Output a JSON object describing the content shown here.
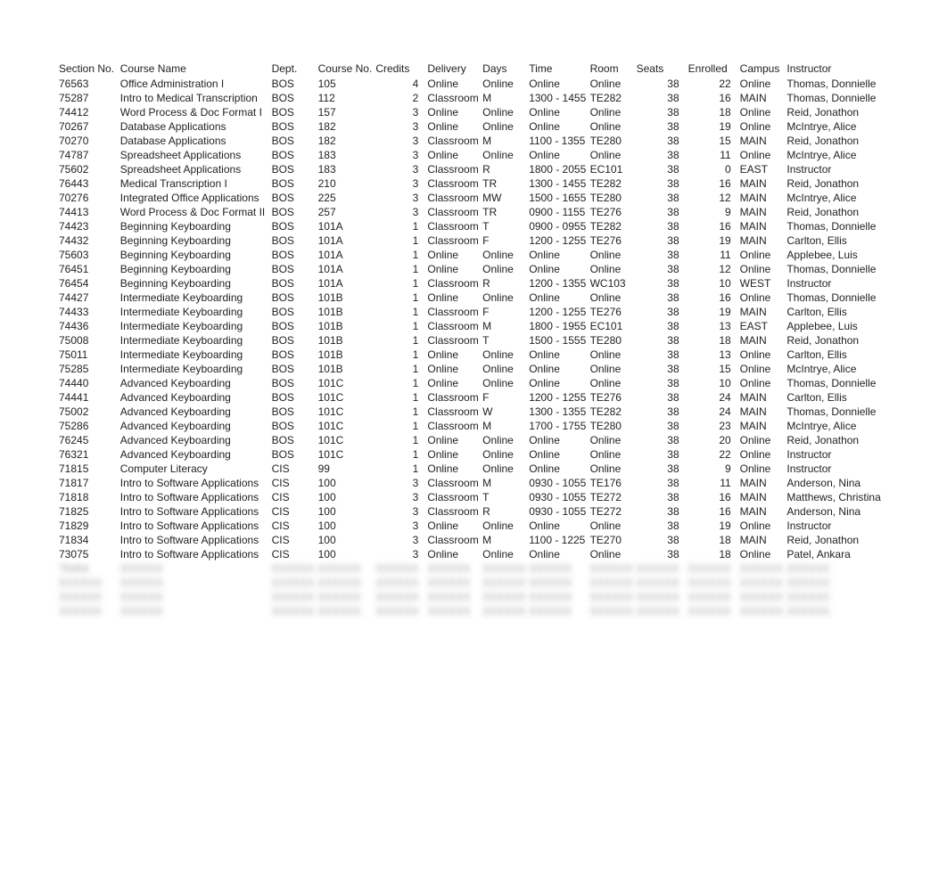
{
  "columns": [
    {
      "key": "section",
      "label": "Section No.",
      "cls": "c-section"
    },
    {
      "key": "name",
      "label": "Course Name",
      "cls": "c-name"
    },
    {
      "key": "dept",
      "label": "Dept.",
      "cls": "c-dept"
    },
    {
      "key": "course",
      "label": "Course No.",
      "cls": "c-course"
    },
    {
      "key": "credits",
      "label": "Credits",
      "cls": "c-credits"
    },
    {
      "key": "delivery",
      "label": "Delivery",
      "cls": "c-delivery"
    },
    {
      "key": "days",
      "label": "Days",
      "cls": "c-days"
    },
    {
      "key": "time",
      "label": "Time",
      "cls": "c-time"
    },
    {
      "key": "room",
      "label": "Room",
      "cls": "c-room"
    },
    {
      "key": "seats",
      "label": "Seats",
      "cls": "c-seats"
    },
    {
      "key": "enrolled",
      "label": "Enrolled",
      "cls": "c-enrolled"
    },
    {
      "key": "campus",
      "label": "Campus",
      "cls": "c-campus"
    },
    {
      "key": "instructor",
      "label": "Instructor",
      "cls": "c-instructor"
    }
  ],
  "rows": [
    {
      "section": "76563",
      "name": "Office Administration I",
      "dept": "BOS",
      "course": "105",
      "credits": "4",
      "delivery": "Online",
      "days": "Online",
      "time": "Online",
      "room": "Online",
      "seats": "38",
      "enrolled": "22",
      "campus": "Online",
      "instructor": "Thomas, Donnielle"
    },
    {
      "section": "75287",
      "name": "Intro to Medical Transcription",
      "dept": "BOS",
      "course": "112",
      "credits": "2",
      "delivery": "Classroom",
      "days": "M",
      "time": "1300 - 1455",
      "room": "TE282",
      "seats": "38",
      "enrolled": "16",
      "campus": "MAIN",
      "instructor": "Thomas, Donnielle"
    },
    {
      "section": "74412",
      "name": "Word Process & Doc Format I",
      "dept": "BOS",
      "course": "157",
      "credits": "3",
      "delivery": "Online",
      "days": "Online",
      "time": "Online",
      "room": "Online",
      "seats": "38",
      "enrolled": "18",
      "campus": "Online",
      "instructor": "Reid, Jonathon"
    },
    {
      "section": "70267",
      "name": "Database Applications",
      "dept": "BOS",
      "course": "182",
      "credits": "3",
      "delivery": "Online",
      "days": "Online",
      "time": "Online",
      "room": "Online",
      "seats": "38",
      "enrolled": "19",
      "campus": "Online",
      "instructor": "McIntrye, Alice"
    },
    {
      "section": "70270",
      "name": "Database Applications",
      "dept": "BOS",
      "course": "182",
      "credits": "3",
      "delivery": "Classroom",
      "days": "M",
      "time": "1100 - 1355",
      "room": "TE280",
      "seats": "38",
      "enrolled": "15",
      "campus": "MAIN",
      "instructor": "Reid, Jonathon"
    },
    {
      "section": "74787",
      "name": "Spreadsheet Applications",
      "dept": "BOS",
      "course": "183",
      "credits": "3",
      "delivery": "Online",
      "days": "Online",
      "time": "Online",
      "room": "Online",
      "seats": "38",
      "enrolled": "11",
      "campus": "Online",
      "instructor": "McIntrye, Alice"
    },
    {
      "section": "75602",
      "name": "Spreadsheet Applications",
      "dept": "BOS",
      "course": "183",
      "credits": "3",
      "delivery": "Classroom",
      "days": "R",
      "time": "1800 - 2055",
      "room": "EC101",
      "seats": "38",
      "enrolled": "0",
      "campus": "EAST",
      "instructor": "Instructor"
    },
    {
      "section": "76443",
      "name": "Medical Transcription I",
      "dept": "BOS",
      "course": "210",
      "credits": "3",
      "delivery": "Classroom",
      "days": "TR",
      "time": "1300 - 1455",
      "room": "TE282",
      "seats": "38",
      "enrolled": "16",
      "campus": "MAIN",
      "instructor": "Reid, Jonathon"
    },
    {
      "section": "70276",
      "name": "Integrated Office Applications",
      "dept": "BOS",
      "course": "225",
      "credits": "3",
      "delivery": "Classroom",
      "days": "MW",
      "time": "1500 - 1655",
      "room": "TE280",
      "seats": "38",
      "enrolled": "12",
      "campus": "MAIN",
      "instructor": "McIntrye, Alice"
    },
    {
      "section": "74413",
      "name": "Word Process & Doc Format II",
      "dept": "BOS",
      "course": "257",
      "credits": "3",
      "delivery": "Classroom",
      "days": "TR",
      "time": "0900 - 1155",
      "room": "TE276",
      "seats": "38",
      "enrolled": "9",
      "campus": "MAIN",
      "instructor": "Reid, Jonathon"
    },
    {
      "section": "74423",
      "name": "Beginning Keyboarding",
      "dept": "BOS",
      "course": "101A",
      "credits": "1",
      "delivery": "Classroom",
      "days": "T",
      "time": "0900 - 0955",
      "room": "TE282",
      "seats": "38",
      "enrolled": "16",
      "campus": "MAIN",
      "instructor": "Thomas, Donnielle"
    },
    {
      "section": "74432",
      "name": "Beginning Keyboarding",
      "dept": "BOS",
      "course": "101A",
      "credits": "1",
      "delivery": "Classroom",
      "days": "F",
      "time": "1200 - 1255",
      "room": "TE276",
      "seats": "38",
      "enrolled": "19",
      "campus": "MAIN",
      "instructor": "Carlton, Ellis"
    },
    {
      "section": "75603",
      "name": "Beginning Keyboarding",
      "dept": "BOS",
      "course": "101A",
      "credits": "1",
      "delivery": "Online",
      "days": "Online",
      "time": "Online",
      "room": "Online",
      "seats": "38",
      "enrolled": "11",
      "campus": "Online",
      "instructor": "Applebee, Luis"
    },
    {
      "section": "76451",
      "name": "Beginning Keyboarding",
      "dept": "BOS",
      "course": "101A",
      "credits": "1",
      "delivery": "Online",
      "days": "Online",
      "time": "Online",
      "room": "Online",
      "seats": "38",
      "enrolled": "12",
      "campus": "Online",
      "instructor": "Thomas, Donnielle"
    },
    {
      "section": "76454",
      "name": "Beginning Keyboarding",
      "dept": "BOS",
      "course": "101A",
      "credits": "1",
      "delivery": "Classroom",
      "days": "R",
      "time": "1200 - 1355",
      "room": "WC103",
      "seats": "38",
      "enrolled": "10",
      "campus": "WEST",
      "instructor": "Instructor"
    },
    {
      "section": "74427",
      "name": "Intermediate Keyboarding",
      "dept": "BOS",
      "course": "101B",
      "credits": "1",
      "delivery": "Online",
      "days": "Online",
      "time": "Online",
      "room": "Online",
      "seats": "38",
      "enrolled": "16",
      "campus": "Online",
      "instructor": "Thomas, Donnielle"
    },
    {
      "section": "74433",
      "name": "Intermediate Keyboarding",
      "dept": "BOS",
      "course": "101B",
      "credits": "1",
      "delivery": "Classroom",
      "days": "F",
      "time": "1200 - 1255",
      "room": "TE276",
      "seats": "38",
      "enrolled": "19",
      "campus": "MAIN",
      "instructor": "Carlton, Ellis"
    },
    {
      "section": "74436",
      "name": "Intermediate Keyboarding",
      "dept": "BOS",
      "course": "101B",
      "credits": "1",
      "delivery": "Classroom",
      "days": "M",
      "time": "1800 - 1955",
      "room": "EC101",
      "seats": "38",
      "enrolled": "13",
      "campus": "EAST",
      "instructor": "Applebee, Luis"
    },
    {
      "section": "75008",
      "name": "Intermediate Keyboarding",
      "dept": "BOS",
      "course": "101B",
      "credits": "1",
      "delivery": "Classroom",
      "days": "T",
      "time": "1500 - 1555",
      "room": "TE280",
      "seats": "38",
      "enrolled": "18",
      "campus": "MAIN",
      "instructor": "Reid, Jonathon"
    },
    {
      "section": "75011",
      "name": "Intermediate Keyboarding",
      "dept": "BOS",
      "course": "101B",
      "credits": "1",
      "delivery": "Online",
      "days": "Online",
      "time": "Online",
      "room": "Online",
      "seats": "38",
      "enrolled": "13",
      "campus": "Online",
      "instructor": "Carlton, Ellis"
    },
    {
      "section": "75285",
      "name": "Intermediate Keyboarding",
      "dept": "BOS",
      "course": "101B",
      "credits": "1",
      "delivery": "Online",
      "days": "Online",
      "time": "Online",
      "room": "Online",
      "seats": "38",
      "enrolled": "15",
      "campus": "Online",
      "instructor": "McIntrye, Alice"
    },
    {
      "section": "74440",
      "name": "Advanced Keyboarding",
      "dept": "BOS",
      "course": "101C",
      "credits": "1",
      "delivery": "Online",
      "days": "Online",
      "time": "Online",
      "room": "Online",
      "seats": "38",
      "enrolled": "10",
      "campus": "Online",
      "instructor": "Thomas, Donnielle"
    },
    {
      "section": "74441",
      "name": "Advanced Keyboarding",
      "dept": "BOS",
      "course": "101C",
      "credits": "1",
      "delivery": "Classroom",
      "days": "F",
      "time": "1200 - 1255",
      "room": "TE276",
      "seats": "38",
      "enrolled": "24",
      "campus": "MAIN",
      "instructor": "Carlton, Ellis"
    },
    {
      "section": "75002",
      "name": "Advanced Keyboarding",
      "dept": "BOS",
      "course": "101C",
      "credits": "1",
      "delivery": "Classroom",
      "days": "W",
      "time": "1300 - 1355",
      "room": "TE282",
      "seats": "38",
      "enrolled": "24",
      "campus": "MAIN",
      "instructor": "Thomas, Donnielle"
    },
    {
      "section": "75286",
      "name": "Advanced Keyboarding",
      "dept": "BOS",
      "course": "101C",
      "credits": "1",
      "delivery": "Classroom",
      "days": "M",
      "time": "1700 - 1755",
      "room": "TE280",
      "seats": "38",
      "enrolled": "23",
      "campus": "MAIN",
      "instructor": "McIntrye, Alice"
    },
    {
      "section": "76245",
      "name": "Advanced Keyboarding",
      "dept": "BOS",
      "course": "101C",
      "credits": "1",
      "delivery": "Online",
      "days": "Online",
      "time": "Online",
      "room": "Online",
      "seats": "38",
      "enrolled": "20",
      "campus": "Online",
      "instructor": "Reid, Jonathon"
    },
    {
      "section": "76321",
      "name": "Advanced Keyboarding",
      "dept": "BOS",
      "course": "101C",
      "credits": "1",
      "delivery": "Online",
      "days": "Online",
      "time": "Online",
      "room": "Online",
      "seats": "38",
      "enrolled": "22",
      "campus": "Online",
      "instructor": "Instructor"
    },
    {
      "section": "71815",
      "name": "Computer Literacy",
      "dept": "CIS",
      "course": "99",
      "credits": "1",
      "delivery": "Online",
      "days": "Online",
      "time": "Online",
      "room": "Online",
      "seats": "38",
      "enrolled": "9",
      "campus": "Online",
      "instructor": "Instructor"
    },
    {
      "section": "71817",
      "name": "Intro to Software Applications",
      "dept": "CIS",
      "course": "100",
      "credits": "3",
      "delivery": "Classroom",
      "days": "M",
      "time": "0930 - 1055",
      "room": "TE176",
      "seats": "38",
      "enrolled": "11",
      "campus": "MAIN",
      "instructor": "Anderson, Nina"
    },
    {
      "section": "71818",
      "name": "Intro to Software Applications",
      "dept": "CIS",
      "course": "100",
      "credits": "3",
      "delivery": "Classroom",
      "days": "T",
      "time": "0930 - 1055",
      "room": "TE272",
      "seats": "38",
      "enrolled": "16",
      "campus": "MAIN",
      "instructor": "Matthews, Christina"
    },
    {
      "section": "71825",
      "name": "Intro to Software Applications",
      "dept": "CIS",
      "course": "100",
      "credits": "3",
      "delivery": "Classroom",
      "days": "R",
      "time": "0930 - 1055",
      "room": "TE272",
      "seats": "38",
      "enrolled": "16",
      "campus": "MAIN",
      "instructor": "Anderson, Nina"
    },
    {
      "section": "71829",
      "name": "Intro to Software Applications",
      "dept": "CIS",
      "course": "100",
      "credits": "3",
      "delivery": "Online",
      "days": "Online",
      "time": "Online",
      "room": "Online",
      "seats": "38",
      "enrolled": "19",
      "campus": "Online",
      "instructor": "Instructor"
    },
    {
      "section": "71834",
      "name": "Intro to Software Applications",
      "dept": "CIS",
      "course": "100",
      "credits": "3",
      "delivery": "Classroom",
      "days": "M",
      "time": "1100 - 1225",
      "room": "TE270",
      "seats": "38",
      "enrolled": "18",
      "campus": "MAIN",
      "instructor": "Reid, Jonathon"
    },
    {
      "section": "73075",
      "name": "Intro to Software Applications",
      "dept": "CIS",
      "course": "100",
      "credits": "3",
      "delivery": "Online",
      "days": "Online",
      "time": "Online",
      "room": "Online",
      "seats": "38",
      "enrolled": "18",
      "campus": "Online",
      "instructor": "Patel, Ankara"
    },
    {
      "section": "75464",
      "name": "",
      "dept": "",
      "course": "",
      "credits": "",
      "delivery": "",
      "days": "",
      "time": "",
      "room": "",
      "seats": "",
      "enrolled": "",
      "campus": "",
      "instructor": "",
      "blurred": true,
      "blurtext": true
    },
    {
      "section": "",
      "name": "",
      "dept": "",
      "course": "",
      "credits": "",
      "delivery": "",
      "days": "",
      "time": "",
      "room": "",
      "seats": "",
      "enrolled": "",
      "campus": "",
      "instructor": "",
      "blurred": true,
      "blurtext": true
    },
    {
      "section": "",
      "name": "",
      "dept": "",
      "course": "",
      "credits": "",
      "delivery": "",
      "days": "",
      "time": "",
      "room": "",
      "seats": "",
      "enrolled": "",
      "campus": "",
      "instructor": "",
      "blurred": true,
      "blurtext": true
    },
    {
      "section": "",
      "name": "",
      "dept": "",
      "course": "",
      "credits": "",
      "delivery": "",
      "days": "",
      "time": "",
      "room": "",
      "seats": "",
      "enrolled": "",
      "campus": "",
      "instructor": "",
      "blurred": true,
      "blurtext": true
    }
  ]
}
